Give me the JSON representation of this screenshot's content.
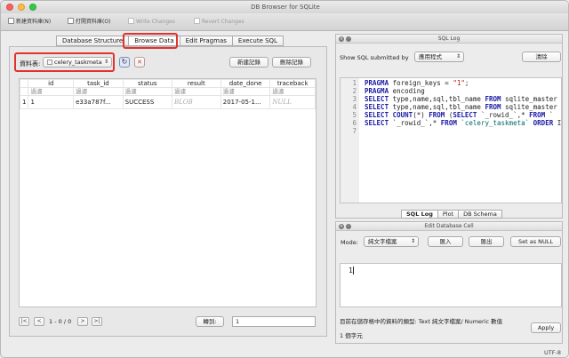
{
  "window": {
    "title": "DB Browser for SQLite"
  },
  "toolbar": {
    "new_db": "新建資料庫(N)",
    "open_db": "打開資料庫(O)",
    "write_changes": "Write Changes",
    "revert_changes": "Revert Changes"
  },
  "tabs": [
    "Database Structure",
    "Browse Data",
    "Edit Pragmas",
    "Execute SQL"
  ],
  "browse": {
    "table_label": "資料表:",
    "table_selected": "celery_taskmeta",
    "new_record": "新建記錄",
    "delete_record": "刪除記錄",
    "columns": [
      "id",
      "task_id",
      "status",
      "result",
      "date_done",
      "traceback"
    ],
    "filter_placeholder": "過濾",
    "rows": [
      {
        "rownum": "1",
        "id": "1",
        "task_id": "e33a787f...",
        "status": "SUCCESS",
        "result": "BLOB",
        "date_done": "2017-05-1...",
        "traceback": "NULL"
      }
    ]
  },
  "pager": {
    "first": "|<",
    "prev": "<",
    "position": "1 - 0 / 0",
    "next": ">",
    "last": ">|",
    "goto_label": "轉到:",
    "goto_value": "1"
  },
  "sql_log": {
    "title": "SQL Log",
    "show_label": "Show SQL submitted by",
    "show_selected": "應用程式",
    "clear": "清除",
    "line_numbers": [
      "1",
      "2",
      "3",
      "4",
      "5",
      "6",
      "7"
    ],
    "lines": [
      "PRAGMA foreign_keys = \"1\";",
      "PRAGMA encoding",
      "SELECT type,name,sql,tbl_name FROM sqlite_master U",
      "SELECT type,name,sql,tbl_name FROM sqlite_master U",
      "SELECT COUNT(*) FROM (SELECT `_rowid_`,* FROM `",
      "SELECT `_rowid_`,* FROM `celery_taskmeta` ORDER I",
      ""
    ]
  },
  "bottom_tabs": [
    "SQL Log",
    "Plot",
    "DB Schema"
  ],
  "edit_cell": {
    "title": "Edit Database Cell",
    "mode_label": "Mode:",
    "mode_selected": "純文字檔案",
    "import": "匯入",
    "export": "匯出",
    "set_null": "Set as NULL",
    "cell_value": "1",
    "type_info": "目前在儲存格中的資料的類型: Text 純文字檔案/ Numeric 數值",
    "size_info": "1 個字元",
    "apply": "Apply"
  },
  "status_bar": {
    "encoding": "UTF-8"
  },
  "colors": {
    "highlight": "#e0332f",
    "keyword": "#1a1aa6"
  }
}
